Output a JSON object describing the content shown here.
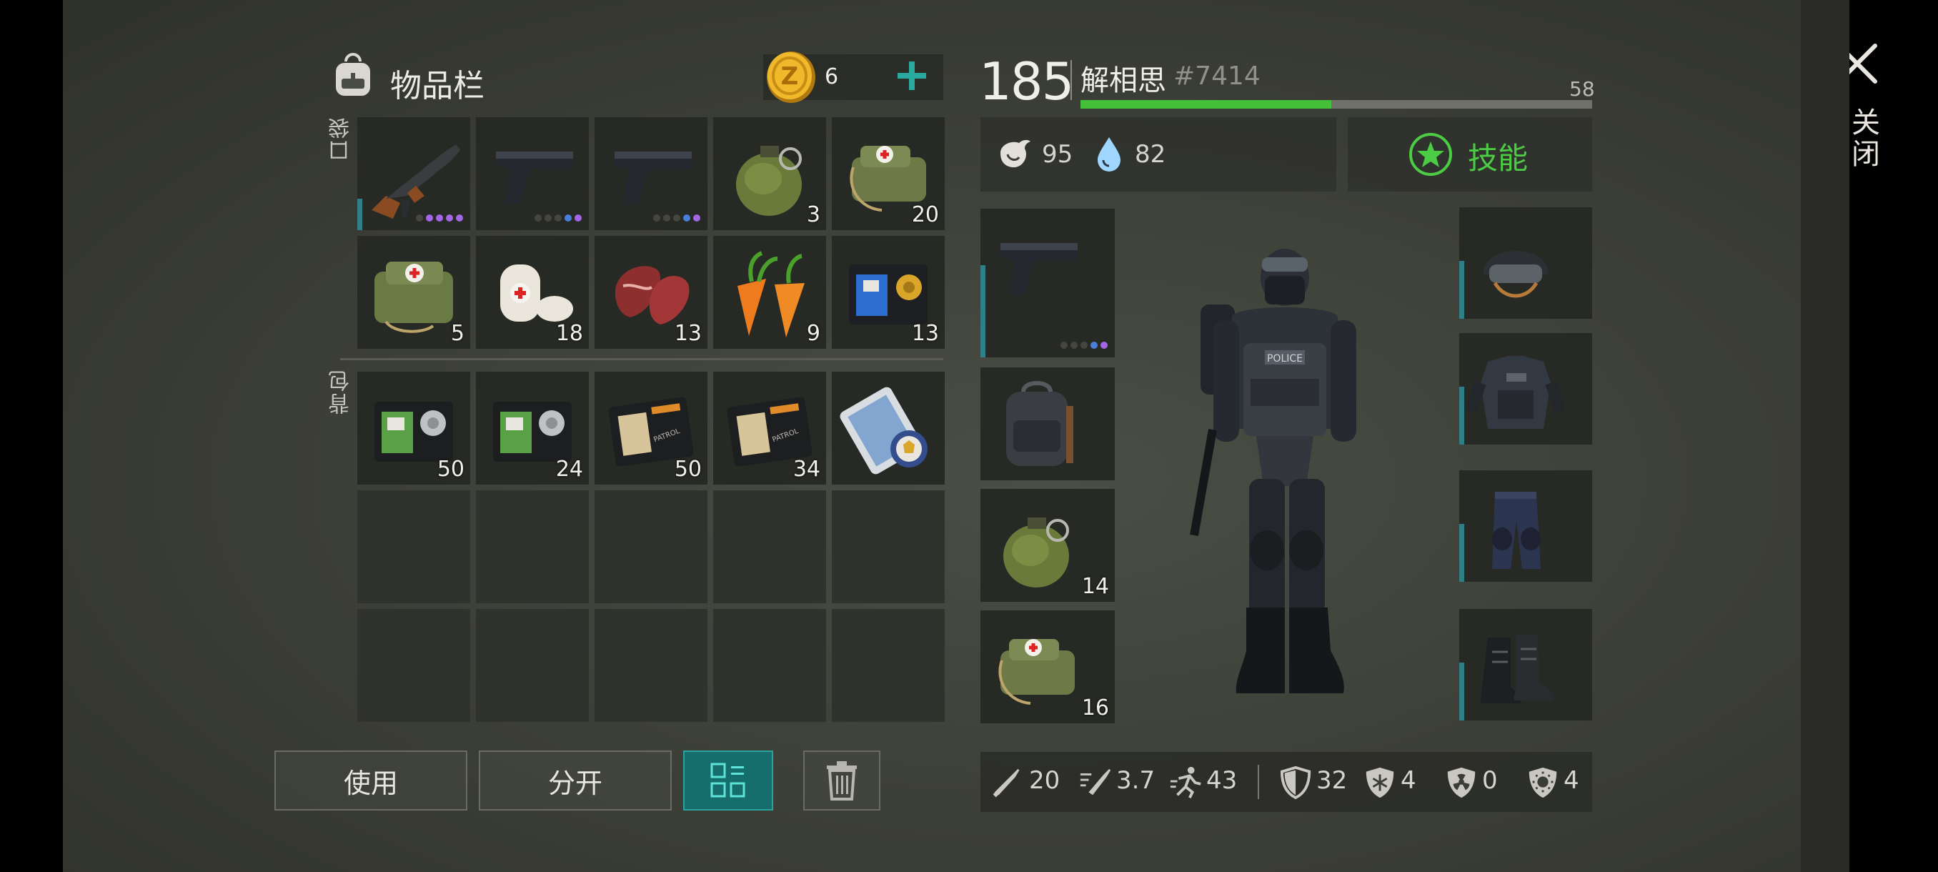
{
  "inventory": {
    "title": "物品栏",
    "coin_count": "6",
    "pocket_label": "口袋",
    "backpack_label": "背包"
  },
  "pocket_items": [
    {
      "name": "ak47-icon",
      "qty": "",
      "dots": [
        "g",
        "p",
        "p",
        "p",
        "p"
      ],
      "bar": 0.28
    },
    {
      "name": "pistol-icon",
      "qty": "",
      "dots": [
        "g",
        "g",
        "g",
        "b",
        "p"
      ],
      "bar": 0
    },
    {
      "name": "pistol-icon",
      "qty": "",
      "dots": [
        "g",
        "g",
        "g",
        "b",
        "p"
      ],
      "bar": 0
    },
    {
      "name": "grenade-icon",
      "qty": "3"
    },
    {
      "name": "medkit-bag-icon",
      "qty": "20"
    },
    {
      "name": "first-aid-kit-icon",
      "qty": "5"
    },
    {
      "name": "bandage-icon",
      "qty": "18"
    },
    {
      "name": "raw-meat-icon",
      "qty": "13"
    },
    {
      "name": "carrot-icon",
      "qty": "9"
    },
    {
      "name": "police-badge-wallet-icon",
      "qty": "13"
    }
  ],
  "backpack_items": [
    {
      "name": "green-id-card-icon",
      "qty": "50"
    },
    {
      "name": "green-id-card-icon",
      "qty": "24"
    },
    {
      "name": "patrol-officer-id-icon",
      "qty": "50"
    },
    {
      "name": "patrol-officer-id-icon",
      "qty": "34"
    },
    {
      "name": "police-blueprint-icon",
      "qty": ""
    },
    {
      "name": "empty-slot",
      "qty": ""
    },
    {
      "name": "empty-slot",
      "qty": ""
    },
    {
      "name": "empty-slot",
      "qty": ""
    },
    {
      "name": "empty-slot",
      "qty": ""
    },
    {
      "name": "empty-slot",
      "qty": ""
    },
    {
      "name": "empty-slot",
      "qty": ""
    },
    {
      "name": "empty-slot",
      "qty": ""
    },
    {
      "name": "empty-slot",
      "qty": ""
    },
    {
      "name": "empty-slot",
      "qty": ""
    },
    {
      "name": "empty-slot",
      "qty": ""
    }
  ],
  "buttons": {
    "use": "使用",
    "split": "分开"
  },
  "player": {
    "level": "185",
    "name": "解相思",
    "tag": "#7414",
    "xp_next_level": "58",
    "xp_progress": 0.49,
    "hunger": "95",
    "thirst": "82",
    "skills_label": "技能"
  },
  "quick_slots": [
    {
      "name": "pistol-icon",
      "qty": "",
      "dots": [
        "g",
        "g",
        "g",
        "b",
        "p"
      ],
      "bar": 0.62
    },
    {
      "name": "backpack-icon",
      "qty": ""
    },
    {
      "name": "grenade-icon",
      "qty": "14"
    },
    {
      "name": "medkit-bag-icon",
      "qty": "16"
    }
  ],
  "armor_slots": [
    {
      "name": "riot-helmet-icon",
      "bar": 0.52
    },
    {
      "name": "police-vest-icon",
      "bar": 0.52
    },
    {
      "name": "tactical-pants-icon",
      "bar": 0.52
    },
    {
      "name": "combat-boots-icon",
      "bar": 0.52
    }
  ],
  "stats": [
    {
      "name": "melee-damage-icon",
      "value": "20"
    },
    {
      "name": "attack-speed-icon",
      "value": "3.7"
    },
    {
      "name": "movement-speed-icon",
      "value": "43"
    },
    {
      "name": "armor-icon",
      "value": "32"
    },
    {
      "name": "cold-resistance-icon",
      "value": "4"
    },
    {
      "name": "radiation-resistance-icon",
      "value": "0"
    },
    {
      "name": "infection-resistance-icon",
      "value": "4"
    }
  ],
  "close_label": "关闭",
  "colors": {
    "xp": "#46c038",
    "skills": "#4ccb44",
    "accent": "#156d6c",
    "plus": "#29a89e"
  }
}
